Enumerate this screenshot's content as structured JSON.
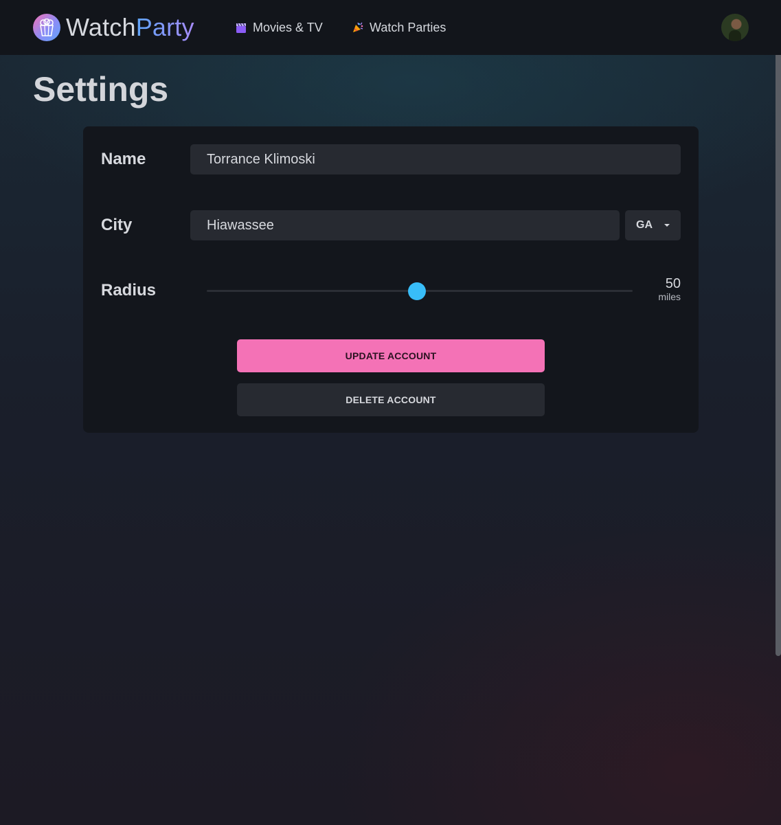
{
  "app": {
    "brand_part1": "Watch",
    "brand_part2": "Party"
  },
  "nav": {
    "items": [
      {
        "label": "Movies & TV",
        "icon": "clapperboard-icon"
      },
      {
        "label": "Watch Parties",
        "icon": "party-popper-icon"
      }
    ],
    "avatar": "user-avatar"
  },
  "page": {
    "title": "Settings"
  },
  "form": {
    "name_label": "Name",
    "name_value": "Torrance Klimoski",
    "city_label": "City",
    "city_value": "Hiawassee",
    "state_value": "GA",
    "radius_label": "Radius",
    "radius_value": "50",
    "radius_unit": "miles",
    "radius_fraction": 0.5,
    "update_label": "UPDATE ACCOUNT",
    "delete_label": "DELETE ACCOUNT"
  },
  "colors": {
    "accent_pink": "#f472b6",
    "slider_blue": "#38bdf8",
    "card_bg": "#13161c",
    "input_bg": "#272a31"
  }
}
